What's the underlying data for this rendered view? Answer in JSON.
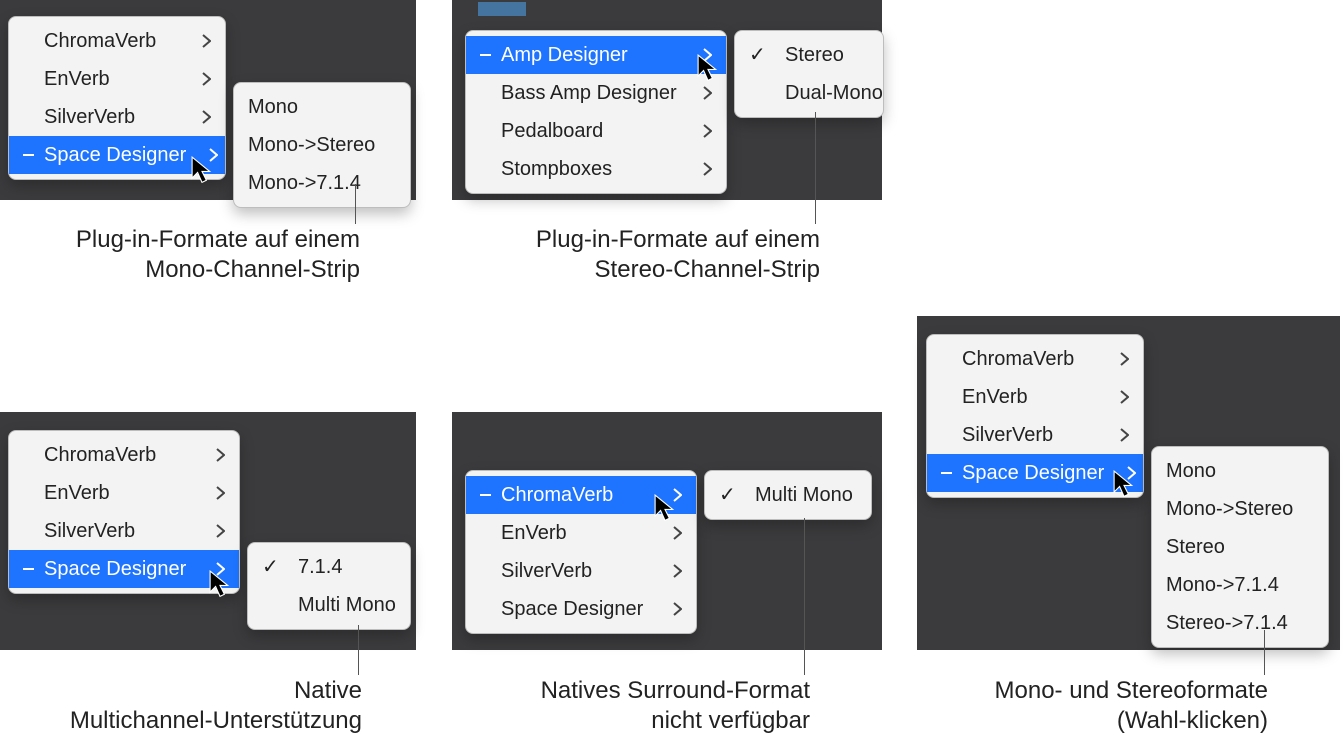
{
  "panels": {
    "p1": {
      "menu1": {
        "items": [
          {
            "label": "ChromaVerb",
            "selected": false
          },
          {
            "label": "EnVerb",
            "selected": false
          },
          {
            "label": "SilverVerb",
            "selected": false
          },
          {
            "label": "Space Designer",
            "selected": true,
            "dash": true
          }
        ]
      },
      "submenu": {
        "items": [
          {
            "label": "Mono"
          },
          {
            "label": "Mono->Stereo"
          },
          {
            "label": "Mono->7.1.4"
          }
        ]
      },
      "caption": "Plug-in-Formate auf einem\nMono-Channel-Strip"
    },
    "p2": {
      "menu1": {
        "items": [
          {
            "label": "Amp Designer",
            "selected": true,
            "dash": true
          },
          {
            "label": "Bass Amp Designer",
            "selected": false
          },
          {
            "label": "Pedalboard",
            "selected": false
          },
          {
            "label": "Stompboxes",
            "selected": false
          }
        ]
      },
      "submenu": {
        "items": [
          {
            "label": "Stereo",
            "check": true
          },
          {
            "label": "Dual-Mono",
            "check": false
          }
        ]
      },
      "caption": "Plug-in-Formate auf einem\nStereo-Channel-Strip"
    },
    "p3": {
      "menu1": {
        "items": [
          {
            "label": "ChromaVerb",
            "selected": false
          },
          {
            "label": "EnVerb",
            "selected": false
          },
          {
            "label": "SilverVerb",
            "selected": false
          },
          {
            "label": "Space Designer",
            "selected": true,
            "dash": true
          }
        ]
      },
      "submenu": {
        "items": [
          {
            "label": "7.1.4",
            "check": true
          },
          {
            "label": "Multi Mono",
            "check": false
          }
        ]
      },
      "caption": "Native\nMultichannel-Unterstützung"
    },
    "p4": {
      "menu1": {
        "items": [
          {
            "label": "ChromaVerb",
            "selected": true,
            "dash": true
          },
          {
            "label": "EnVerb",
            "selected": false
          },
          {
            "label": "SilverVerb",
            "selected": false
          },
          {
            "label": "Space Designer",
            "selected": false
          }
        ]
      },
      "submenu": {
        "items": [
          {
            "label": "Multi Mono",
            "check": true
          }
        ]
      },
      "caption": "Natives Surround-Format\nnicht verfügbar"
    },
    "p5": {
      "menu1": {
        "items": [
          {
            "label": "ChromaVerb",
            "selected": false
          },
          {
            "label": "EnVerb",
            "selected": false
          },
          {
            "label": "SilverVerb",
            "selected": false
          },
          {
            "label": "Space Designer",
            "selected": true,
            "dash": true
          }
        ]
      },
      "submenu": {
        "items": [
          {
            "label": "Mono"
          },
          {
            "label": "Mono->Stereo"
          },
          {
            "label": "Stereo"
          },
          {
            "label": "Mono->7.1.4"
          },
          {
            "label": "Stereo->7.1.4"
          }
        ]
      },
      "caption": "Mono- und Stereoformate\n(Wahl-klicken)"
    }
  }
}
